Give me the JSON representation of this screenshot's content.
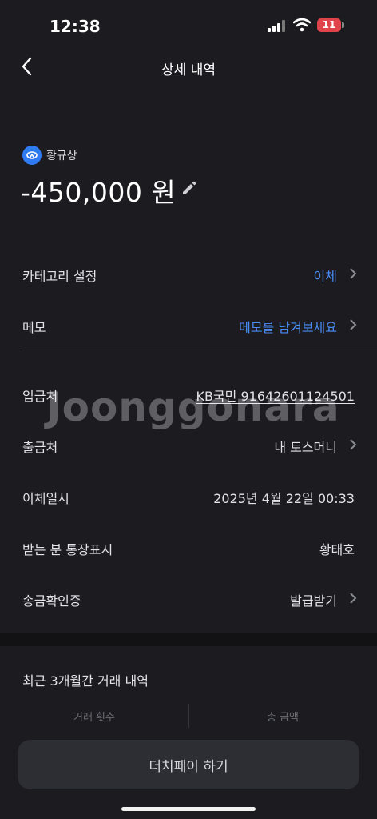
{
  "status_bar": {
    "time": "12:38",
    "battery": "11"
  },
  "nav": {
    "title": "상세 내역"
  },
  "header": {
    "sender_name": "황규상",
    "amount": "-450,000 원"
  },
  "rows": [
    {
      "label": "카테고리 설정",
      "value": "이체"
    },
    {
      "label": "메모",
      "value": "메모를 남겨보세요"
    },
    {
      "label": "입금처",
      "value": "KB국민 91642601124501"
    },
    {
      "label": "출금처",
      "value": "내 토스머니"
    },
    {
      "label": "이체일시",
      "value": "2025년 4월 22일 00:33"
    },
    {
      "label": "받는 분 통장표시",
      "value": "황태호"
    },
    {
      "label": "송금확인증",
      "value": "발급받기"
    }
  ],
  "history": {
    "title": "최근 3개월간 거래 내역",
    "count_label": "거래 횟수",
    "total_label": "총 금액"
  },
  "bottom": {
    "button_label": "더치페이 하기"
  },
  "watermark": "Joonggonara",
  "colors": {
    "accent": "#4a8cf5",
    "background": "#1b1b20",
    "battery": "#e1434a"
  }
}
